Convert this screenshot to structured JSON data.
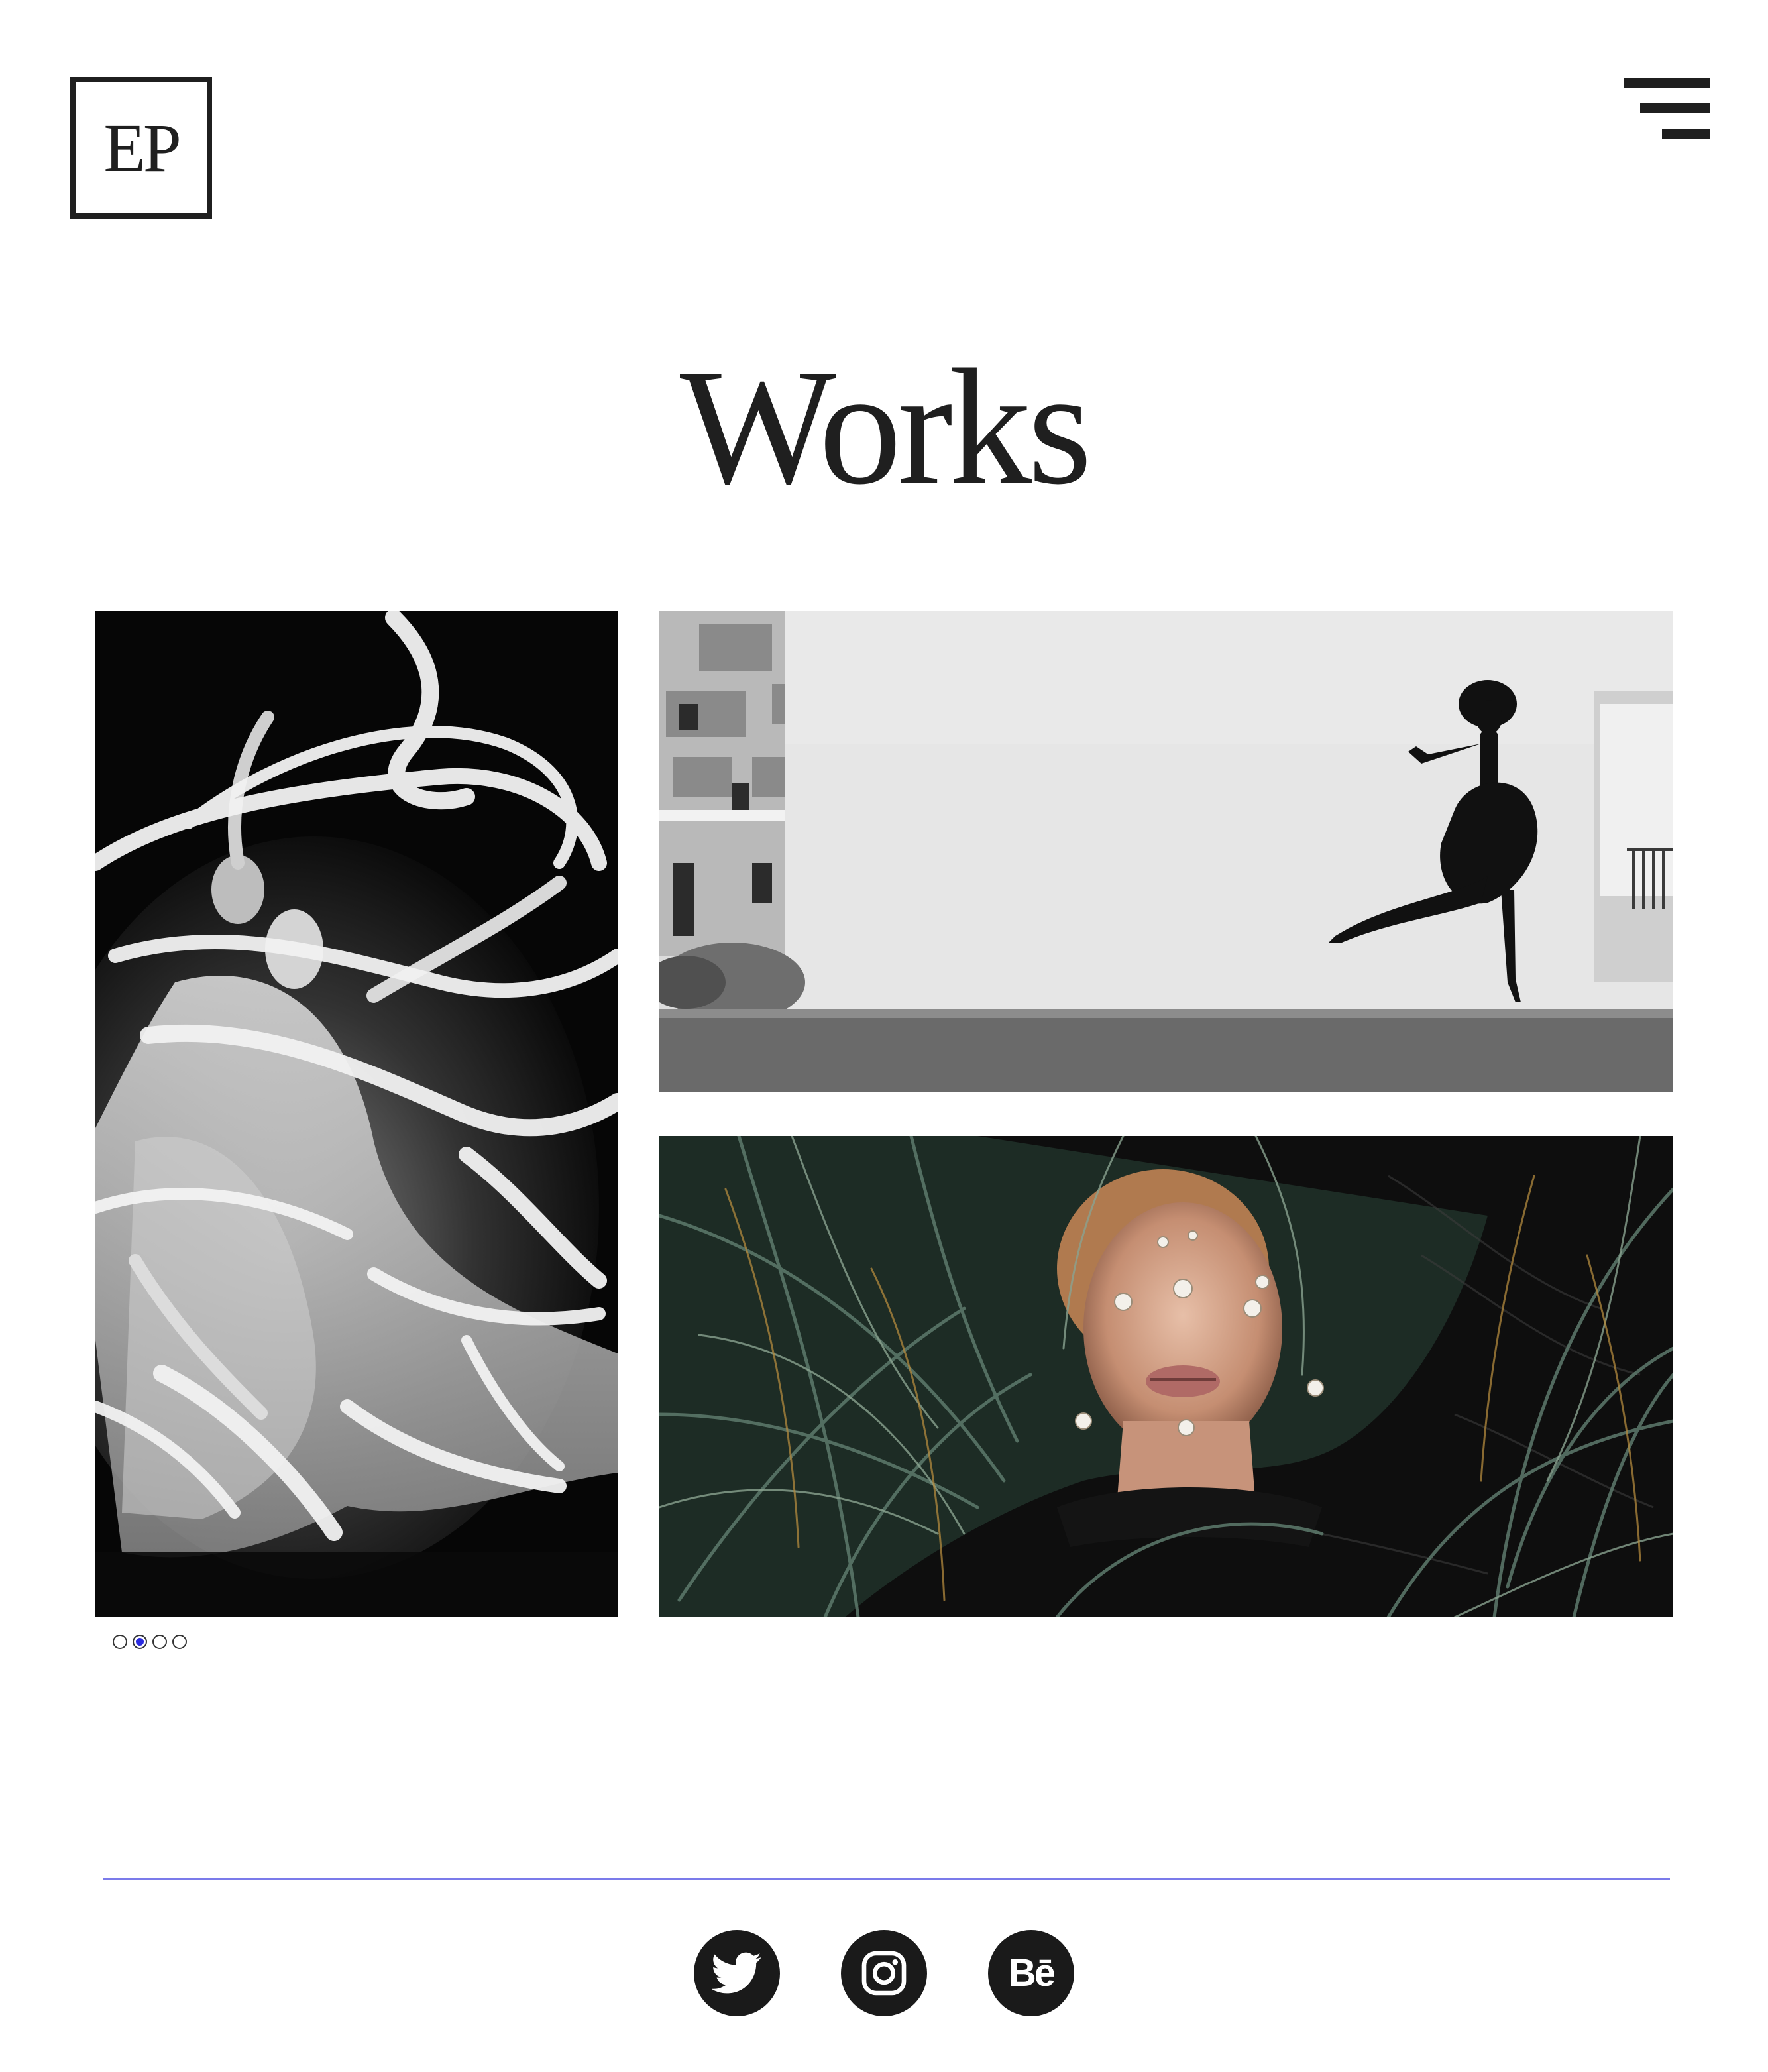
{
  "header": {
    "logo_text": "EP",
    "menu_icon": "hamburger-menu-icon"
  },
  "main": {
    "title": "Works",
    "gallery": [
      {
        "name": "dancer-ribbons-photo",
        "tone": "monochrome"
      },
      {
        "name": "jumping-woman-photo",
        "tone": "monochrome"
      },
      {
        "name": "woman-in-grass-photo",
        "tone": "color"
      }
    ],
    "carousel": {
      "count": 4,
      "active_index": 1,
      "active_color": "#2a2ae0"
    }
  },
  "footer": {
    "divider_color": "#7b7bea",
    "social": [
      {
        "name": "twitter",
        "icon": "twitter-bird-icon"
      },
      {
        "name": "instagram",
        "icon": "instagram-camera-icon"
      },
      {
        "name": "behance",
        "icon": "behance-icon",
        "label": "Bē"
      }
    ]
  }
}
